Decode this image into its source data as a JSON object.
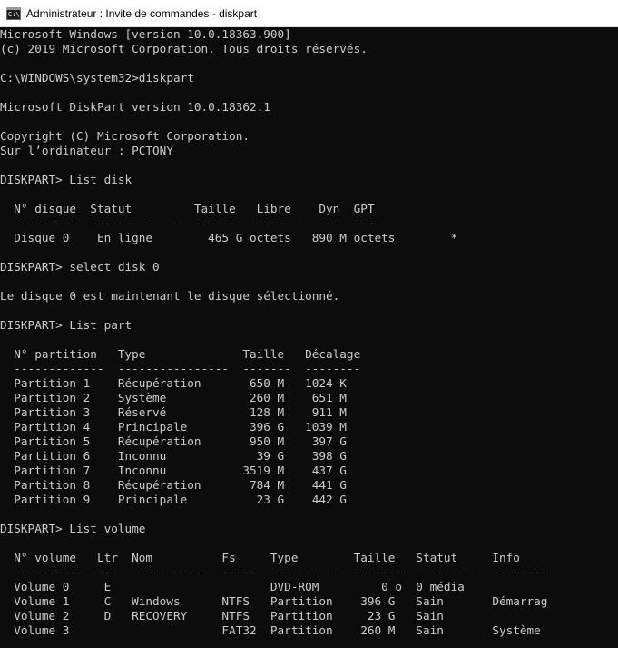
{
  "window": {
    "title": "Administrateur : Invite de commandes - diskpart",
    "icon": "cmd-icon",
    "icon_glyph": "C:\\",
    "background": "#0c0c0c",
    "text_color": "#cccccc"
  },
  "console": {
    "lines": [
      "Microsoft Windows [version 10.0.18363.900]",
      "(c) 2019 Microsoft Corporation. Tous droits réservés.",
      "",
      "C:\\WINDOWS\\system32>diskpart",
      "",
      "Microsoft DiskPart version 10.0.18362.1",
      "",
      "Copyright (C) Microsoft Corporation.",
      "Sur l’ordinateur : PCTONY",
      "",
      "DISKPART> List disk",
      "",
      "  N° disque  Statut         Taille   Libre    Dyn  GPT",
      "  ---------  -------------  -------  -------  ---  ---",
      "  Disque 0    En ligne        465 G octets   890 M octets        *",
      "",
      "DISKPART> select disk 0",
      "",
      "Le disque 0 est maintenant le disque sélectionné.",
      "",
      "DISKPART> List part",
      "",
      "  N° partition   Type              Taille   Décalage",
      "  -------------  ----------------  -------  --------",
      "  Partition 1    Récupération       650 M   1024 K",
      "  Partition 2    Système            260 M    651 M",
      "  Partition 3    Réservé            128 M    911 M",
      "  Partition 4    Principale         396 G   1039 M",
      "  Partition 5    Récupération       950 M    397 G",
      "  Partition 6    Inconnu             39 G    398 G",
      "  Partition 7    Inconnu           3519 M    437 G",
      "  Partition 8    Récupération       784 M    441 G",
      "  Partition 9    Principale          23 G    442 G",
      "",
      "DISKPART> List volume",
      "",
      "  N° volume   Ltr  Nom          Fs     Type        Taille   Statut     Info",
      "  ----------  ---  -----------  -----  ----------  -------  ---------  --------",
      "  Volume 0     E                       DVD-ROM         0 o  0 média",
      "  Volume 1     C   Windows      NTFS   Partition    396 G   Sain       Démarrag",
      "  Volume 2     D   RECOVERY     NTFS   Partition     23 G   Sain",
      "  Volume 3                      FAT32  Partition    260 M   Sain       Système"
    ]
  }
}
